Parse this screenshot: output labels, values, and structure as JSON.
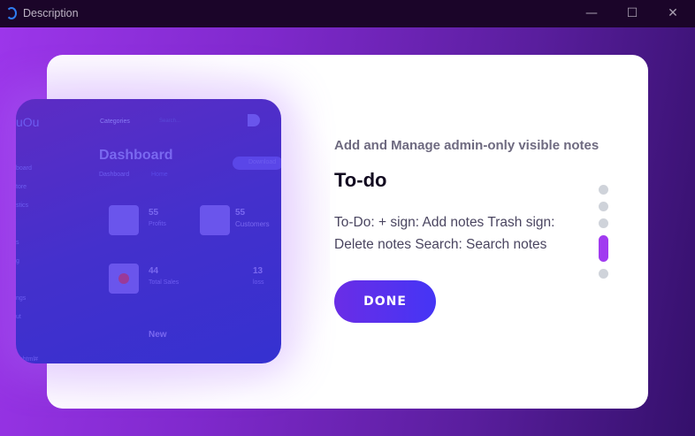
{
  "window": {
    "title": "Description",
    "minimize": "—",
    "maximize": "☐",
    "close": "✕"
  },
  "preview": {
    "logo": "uOu",
    "sidebar": [
      "board",
      "tore",
      "stics",
      "s",
      "g",
      "ngs",
      "ut",
      "ophtml#"
    ],
    "menu": "Categories",
    "search": "Search...",
    "title": "Dashboard",
    "breadcrumb": [
      "Dashboard",
      "Home"
    ],
    "download": "Download",
    "stats": [
      {
        "value": "55",
        "label": "Profits"
      },
      {
        "value": "55",
        "label": "Customers"
      },
      {
        "value": "44",
        "label": "Total Sales"
      },
      {
        "value": "13",
        "label": "loss"
      }
    ],
    "new_label": "New"
  },
  "content": {
    "subtitle": "Add and Manage admin-only visible notes",
    "heading": "To-do",
    "description": "To-Do: + sign: Add notes Trash sign: Delete notes Search: Search notes",
    "done_label": "DONE"
  },
  "pagination": {
    "total": 5,
    "active": 4
  }
}
